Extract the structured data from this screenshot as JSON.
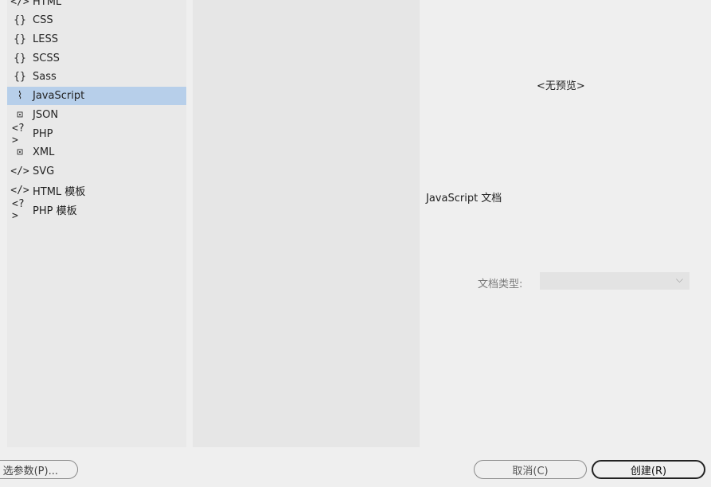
{
  "sidebar": {
    "items": [
      {
        "icon": "code-tag-icon",
        "glyph": "</>",
        "label": "HTML",
        "selected": false
      },
      {
        "icon": "braces-icon",
        "glyph": "{}",
        "label": "CSS",
        "selected": false
      },
      {
        "icon": "braces-icon",
        "glyph": "{}",
        "label": "LESS",
        "selected": false
      },
      {
        "icon": "braces-icon",
        "glyph": "{}",
        "label": "SCSS",
        "selected": false
      },
      {
        "icon": "braces-icon",
        "glyph": "{}",
        "label": "Sass",
        "selected": false
      },
      {
        "icon": "script-scroll-icon",
        "glyph": "⌇",
        "label": "JavaScript",
        "selected": true
      },
      {
        "icon": "json-file-icon",
        "glyph": "⊡",
        "label": "JSON",
        "selected": false
      },
      {
        "icon": "php-tag-icon",
        "glyph": "<?>",
        "label": "PHP",
        "selected": false
      },
      {
        "icon": "xml-file-icon",
        "glyph": "⊡",
        "label": "XML",
        "selected": false
      },
      {
        "icon": "code-tag-icon",
        "glyph": "</>",
        "label": "SVG",
        "selected": false
      },
      {
        "icon": "code-tag-icon",
        "glyph": "</>",
        "label": "HTML 模板",
        "selected": false
      },
      {
        "icon": "php-tag-icon",
        "glyph": "<?>",
        "label": "PHP 模板",
        "selected": false
      }
    ]
  },
  "preview": {
    "no_preview_text": "<无预览>",
    "description": "JavaScript  文档"
  },
  "doctype": {
    "label": "文档类型:",
    "value": ""
  },
  "buttons": {
    "prefs_label": "选参数(P)...",
    "cancel_label": "取消(C)",
    "create_label": "创建(R)"
  },
  "colors": {
    "selection": "#b7cfea",
    "panel": "#e9e9e9",
    "background": "#efefef"
  }
}
